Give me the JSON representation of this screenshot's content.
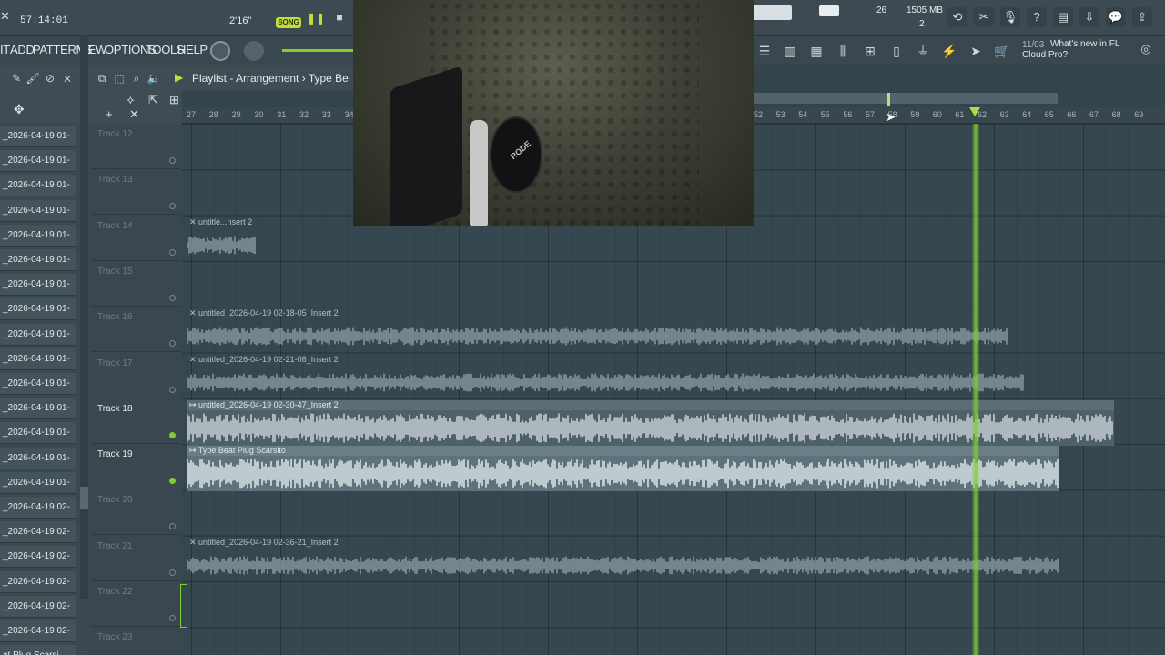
{
  "transport": {
    "time": "57:14:01",
    "duration": "2'16\"",
    "song_label": "SONG",
    "cpu": "26",
    "memory": "1505 MB",
    "polyphony": "2"
  },
  "menu": {
    "items": [
      "IT",
      "ADD",
      "PATTERNS",
      "VIEW",
      "OPTIONS",
      "TOOLS",
      "HELP"
    ]
  },
  "news": {
    "count": "11/03",
    "text": "What's new in FL",
    "text2": "Cloud Pro?"
  },
  "playlist": {
    "title": "Playlist - Arrangement › Type Be"
  },
  "picker": {
    "items": [
      "_2026-04-19 01-",
      "_2026-04-19 01-",
      "_2026-04-19 01-",
      "_2026-04-19 01-",
      "_2026-04-19 01-",
      "_2026-04-19 01-",
      "_2026-04-19 01-",
      "_2026-04-19 01-",
      "_2026-04-19 01-",
      "_2026-04-19 01-",
      "_2026-04-19 01-",
      "_2026-04-19 01-",
      "_2026-04-19 01-",
      "_2026-04-19 01-",
      "_2026-04-19 01-",
      "_2026-04-19 02-",
      "_2026-04-19 02-",
      "_2026-04-19 02-",
      "_2026-04-19 02-",
      "_2026-04-19 02-",
      "_2026-04-19 02-",
      "at Plug Scarsi"
    ]
  },
  "tracks": [
    {
      "name": "Track 12",
      "active": false
    },
    {
      "name": "Track 13",
      "active": false
    },
    {
      "name": "Track 14",
      "active": false
    },
    {
      "name": "Track 15",
      "active": false
    },
    {
      "name": "Track 16",
      "active": false
    },
    {
      "name": "Track 17",
      "active": false
    },
    {
      "name": "Track 18",
      "active": true
    },
    {
      "name": "Track 19",
      "active": true
    },
    {
      "name": "Track 20",
      "active": false
    },
    {
      "name": "Track 21",
      "active": false
    },
    {
      "name": "Track 22",
      "active": false
    },
    {
      "name": "Track 23",
      "active": false
    }
  ],
  "timeline": {
    "bars": [
      "27",
      "28",
      "29",
      "30",
      "31",
      "32",
      "33",
      "34",
      "52",
      "53",
      "54",
      "55",
      "56",
      "57",
      "58",
      "59",
      "60",
      "61",
      "62",
      "63",
      "64",
      "65",
      "66",
      "67",
      "68",
      "69"
    ]
  },
  "clips": [
    {
      "label": "✕ untitle...nsert 2",
      "style": "ghost",
      "track": 2
    },
    {
      "label": "✕ untitled_2026-04-19 02-18-05_Insert 2",
      "style": "ghost",
      "track": 4
    },
    {
      "label": "✕ untitled_2026-04-19 02-21-08_Insert 2",
      "style": "ghost",
      "track": 5
    },
    {
      "label": "↦ untitled_2026-04-19 02-30-47_Insert 2",
      "style": "solid",
      "track": 6
    },
    {
      "label": "↦ Type Beat Plug Scarsito",
      "style": "bright",
      "track": 7
    },
    {
      "label": "✕ untitled_2026-04-19 02-36-21_Insert 2",
      "style": "ghost",
      "track": 9
    }
  ],
  "webcam": {
    "brand_label": "RODE"
  }
}
